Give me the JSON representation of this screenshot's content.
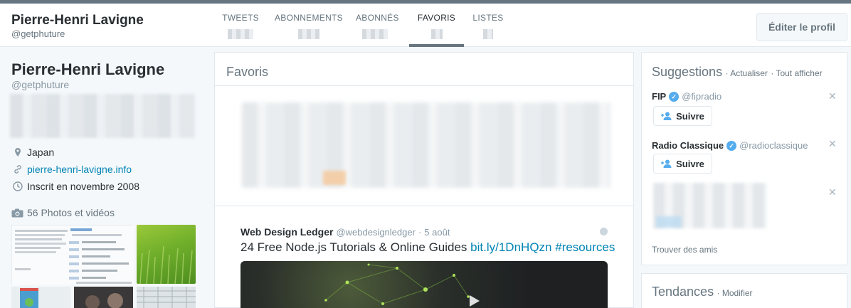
{
  "profile": {
    "name": "Pierre-Henri Lavigne",
    "handle": "@getphuture"
  },
  "nav": {
    "tabs": [
      {
        "label": "TWEETS"
      },
      {
        "label": "ABONNEMENTS"
      },
      {
        "label": "ABONNÉS"
      },
      {
        "label": "FAVORIS",
        "active": true
      },
      {
        "label": "LISTES"
      }
    ],
    "edit_label": "Éditer le profil"
  },
  "sidebar": {
    "location": "Japan",
    "website": "pierre-henri-lavigne.info",
    "joined": "Inscrit en novembre 2008",
    "photos_label": "56 Photos et vidéos"
  },
  "main": {
    "title": "Favoris",
    "tweet": {
      "author": "Web Design Ledger",
      "handle": "@webdesignledger",
      "sep": "·",
      "time": "5 août",
      "text": "24 Free Node.js Tutorials & Online Guides",
      "link": "bit.ly/1DnHQzn",
      "hashtag": "#resources"
    }
  },
  "suggestions": {
    "title": "Suggestions",
    "refresh": "· Actualiser",
    "view_all": "· Tout afficher",
    "follow_label": "Suivre",
    "items": [
      {
        "name": "FIP",
        "handle": "@fipradio"
      },
      {
        "name": "Radio Classique",
        "handle": "@radioclassique"
      }
    ],
    "find_friends": "Trouver des amis"
  },
  "trends": {
    "title": "Tendances",
    "edit": "· Modifier"
  },
  "colors": {
    "accent": "#0084b4",
    "verified": "#55acee",
    "tab_active": "#66757f"
  }
}
